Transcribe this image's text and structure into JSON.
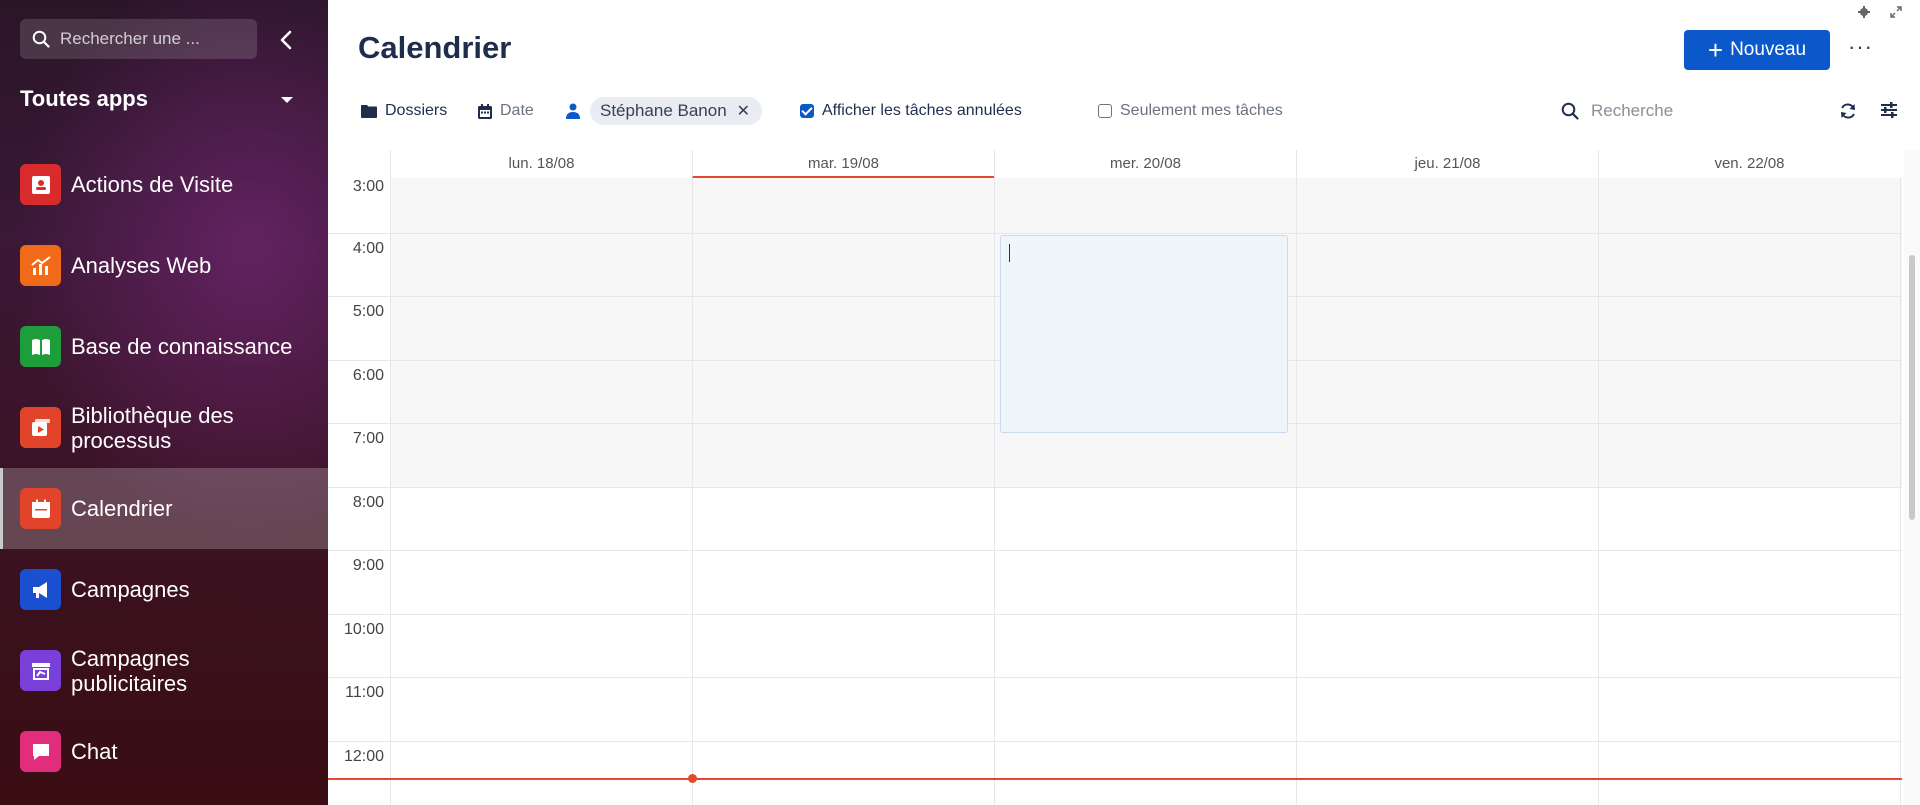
{
  "sidebar": {
    "search_placeholder": "Rechercher une ...",
    "apps_title": "Toutes apps",
    "items": [
      {
        "label": "Actions de Visite",
        "icon": "visit-actions-icon",
        "color": "#d92b2b"
      },
      {
        "label": "Analyses Web",
        "icon": "web-analytics-icon",
        "color": "#f06a1a"
      },
      {
        "label": "Base de connaissance",
        "icon": "knowledge-book-icon",
        "color": "#1e9e3a"
      },
      {
        "label": "Bibliothèque des processus",
        "icon": "process-library-icon",
        "color": "#e2442b"
      },
      {
        "label": "Calendrier",
        "icon": "calendar-icon",
        "color": "#e2442b"
      },
      {
        "label": "Campagnes",
        "icon": "megaphone-icon",
        "color": "#1a4fcf"
      },
      {
        "label": "Campagnes publicitaires",
        "icon": "ad-campaign-icon",
        "color": "#7b3fd9"
      },
      {
        "label": "Chat",
        "icon": "chat-icon",
        "color": "#e02d7c"
      }
    ]
  },
  "header": {
    "title": "Calendrier",
    "new_button": "Nouveau",
    "more": "···"
  },
  "filters": {
    "folders": "Dossiers",
    "date": "Date",
    "user_chip": "Stéphane Banon",
    "show_cancelled": "Afficher les tâches annulées",
    "show_cancelled_checked": true,
    "only_mine": "Seulement mes tâches",
    "only_mine_checked": false,
    "search_placeholder": "Recherche"
  },
  "calendar": {
    "days": [
      "lun. 18/08",
      "mar. 19/08",
      "mer. 20/08",
      "jeu. 21/08",
      "ven. 22/08"
    ],
    "today_index": 1,
    "hours": [
      "3:00",
      "4:00",
      "5:00",
      "6:00",
      "7:00",
      "8:00",
      "9:00",
      "10:00",
      "11:00",
      "12:00"
    ],
    "selection": {
      "day_index": 2,
      "start": "4:00",
      "end": "7:30"
    }
  },
  "colors": {
    "primary": "#0a58ca",
    "now_indicator": "#e5472f",
    "title": "#1f2d4d"
  }
}
